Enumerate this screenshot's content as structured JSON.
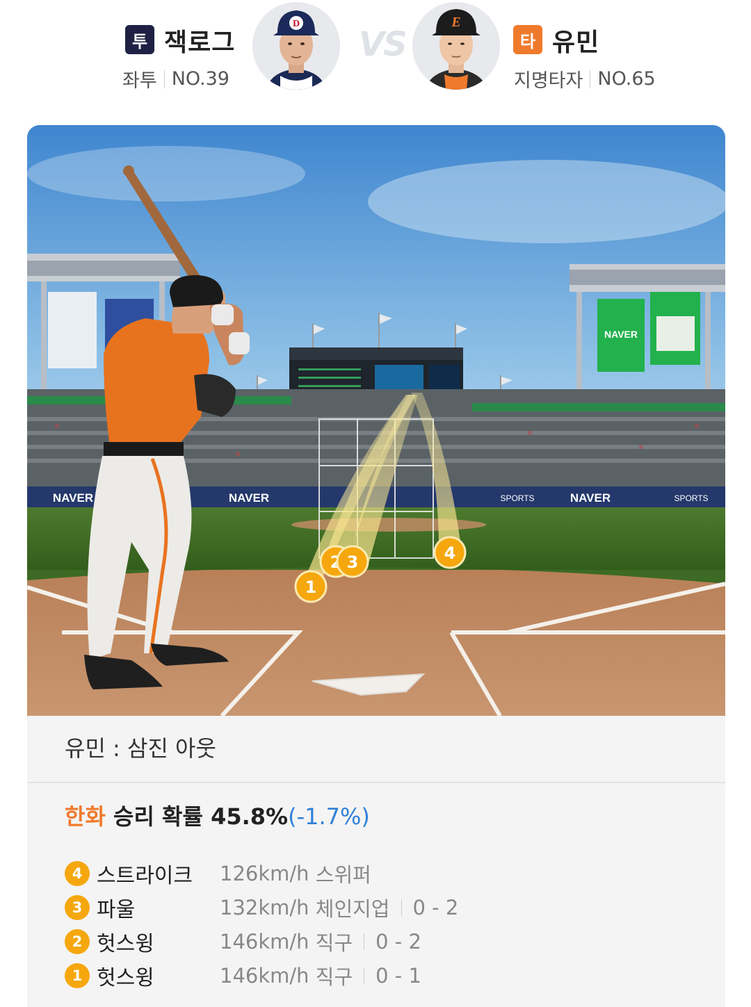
{
  "pitcher": {
    "role_badge": "투",
    "name": "잭로그",
    "throws": "좌투",
    "number": "NO.39",
    "badge_color": "#1f2144"
  },
  "batter": {
    "role_badge": "타",
    "name": "유민",
    "position": "지명타자",
    "number": "NO.65",
    "badge_color": "#f07a2c"
  },
  "vs_label": "VS",
  "pitch_markers": [
    "1",
    "2",
    "3",
    "4"
  ],
  "at_bat_result": "유민 : 삼진 아웃",
  "win_probability": {
    "team": "한화",
    "label": " 승리 확률 ",
    "value": "45.8%",
    "change": "(-1.7%)"
  },
  "pitches": [
    {
      "num": "4",
      "result": "스트라이크",
      "speed": "126km/h",
      "type": "스위퍼",
      "count": ""
    },
    {
      "num": "3",
      "result": "파울",
      "speed": "132km/h",
      "type": "체인지업",
      "count": "0 - 2"
    },
    {
      "num": "2",
      "result": "헛스윙",
      "speed": "146km/h",
      "type": "직구",
      "count": "0 - 2"
    },
    {
      "num": "1",
      "result": "헛스윙",
      "speed": "146km/h",
      "type": "직구",
      "count": "0 - 1"
    }
  ],
  "colors": {
    "accent_orange": "#f07a2c",
    "change_blue": "#2f7fd8",
    "marker_yellow": "#f5a70d",
    "naver_green": "#22b14c"
  },
  "stage_signage": {
    "brand": "NAVER",
    "sports": "SPORTS"
  }
}
